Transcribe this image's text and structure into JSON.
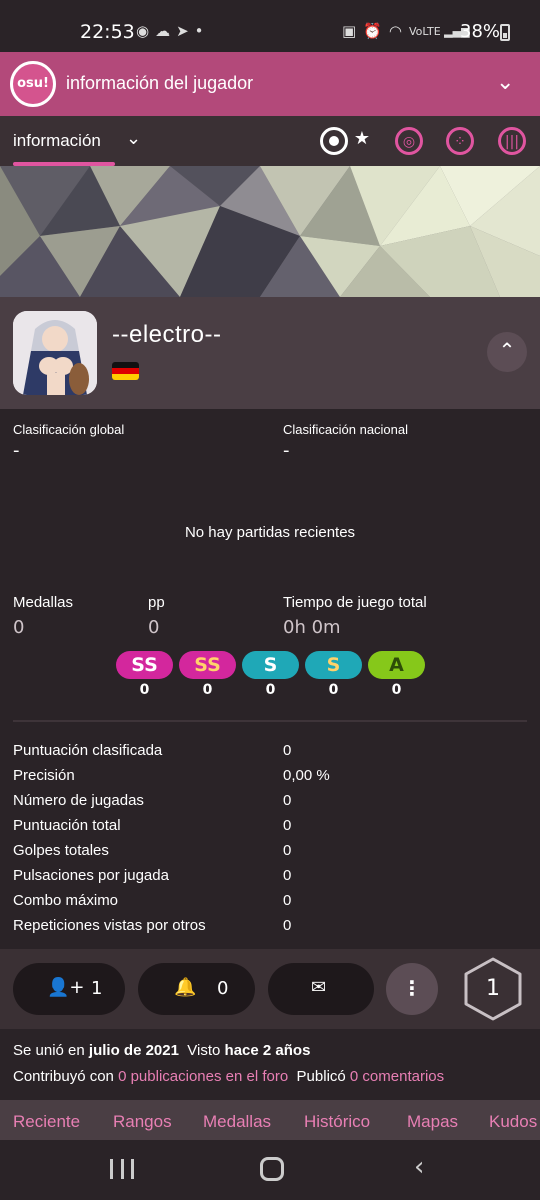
{
  "status_bar": {
    "time": "22:53",
    "battery": "38%"
  },
  "header": {
    "logo_text": "osu!",
    "title": "información del jugador"
  },
  "tabs": {
    "current": "información"
  },
  "profile": {
    "username": "--electro--",
    "country_flag": "Germany"
  },
  "rankings": {
    "global_label": "Clasificación global",
    "global_value": "-",
    "national_label": "Clasificación nacional",
    "national_value": "-"
  },
  "recent": {
    "empty_text": "No hay partidas recientes"
  },
  "summary": {
    "medals_label": "Medallas",
    "medals_value": "0",
    "pp_label": "pp",
    "pp_value": "0",
    "playtime_label": "Tiempo de juego total",
    "playtime_value": "0h 0m"
  },
  "grades": [
    {
      "label": "SS",
      "count": "0",
      "color": "#d3279d"
    },
    {
      "label": "SS",
      "count": "0",
      "color": "#d3279d"
    },
    {
      "label": "S",
      "count": "0",
      "color": "#1fa8b7"
    },
    {
      "label": "S",
      "count": "0",
      "color": "#1fa8b7"
    },
    {
      "label": "A",
      "count": "0",
      "color": "#86c81a"
    }
  ],
  "stats": [
    {
      "label": "Puntuación clasificada",
      "value": "0"
    },
    {
      "label": "Precisión",
      "value": "0,00 %"
    },
    {
      "label": "Número de jugadas",
      "value": "0"
    },
    {
      "label": "Puntuación total",
      "value": "0"
    },
    {
      "label": "Golpes totales",
      "value": "0"
    },
    {
      "label": "Pulsaciones por jugada",
      "value": "0"
    },
    {
      "label": "Combo máximo",
      "value": "0"
    },
    {
      "label": "Repeticiones vistas por otros",
      "value": "0"
    }
  ],
  "actions": {
    "followers": "1",
    "mapping_subscribers": "0",
    "level": "1"
  },
  "info": {
    "joined_prefix": "Se unió en",
    "joined_date": "julio de 2021",
    "seen_prefix": "Visto",
    "seen_value": "hace 2 años",
    "contrib_prefix": "Contribuyó con",
    "contrib_link": "0 publicaciones en el foro",
    "posted_prefix": "Publicó",
    "posted_link": "0 comentarios"
  },
  "bottom_tabs": [
    "Reciente",
    "Rangos",
    "Medallas",
    "Histórico",
    "Mapas",
    "Kudos"
  ],
  "colors": {
    "accent": "#b3497a",
    "pink": "#e055a0",
    "link": "#e87fb4"
  }
}
